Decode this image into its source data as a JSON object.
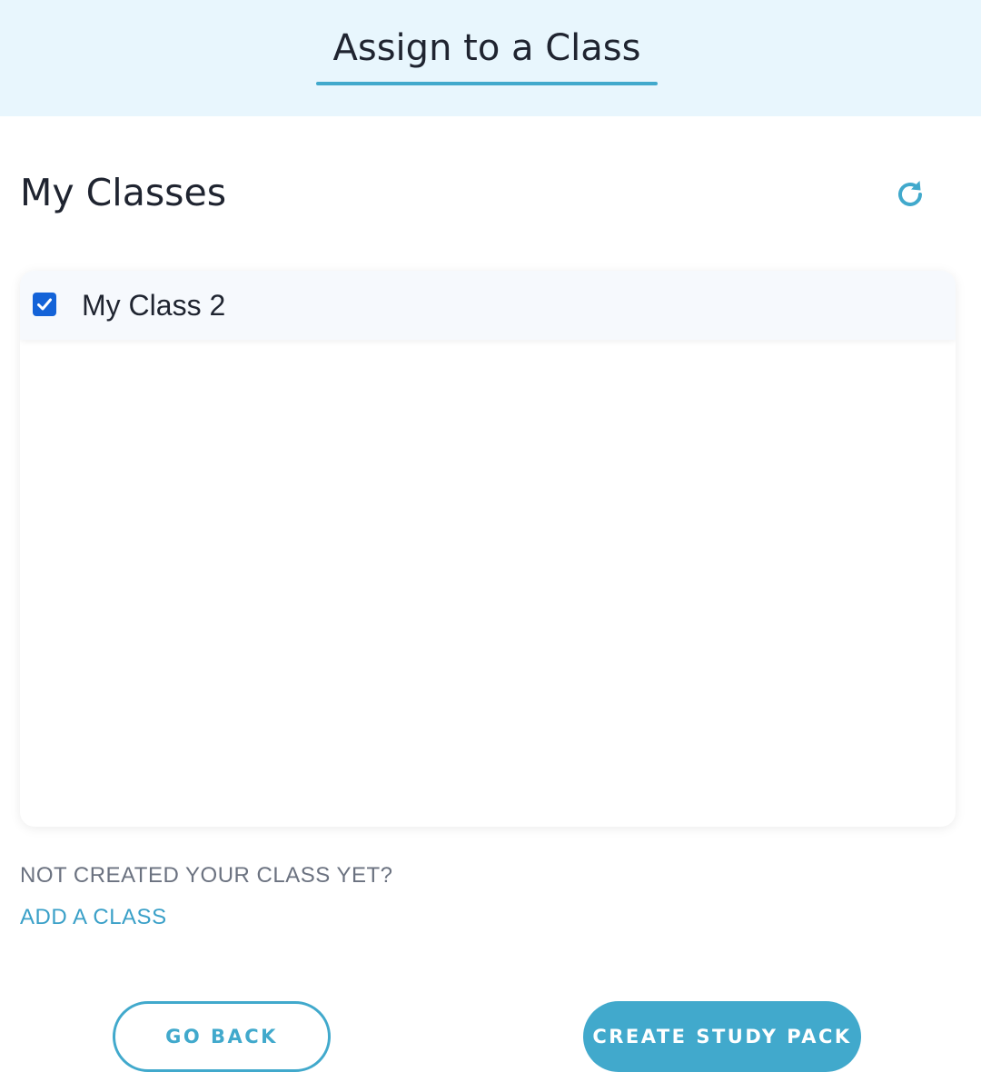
{
  "header": {
    "title": "Assign to a Class"
  },
  "classes_section": {
    "title": "My Classes",
    "refresh_icon": "refresh-icon",
    "items": [
      {
        "label": "My Class 2",
        "checked": true
      }
    ]
  },
  "footer_prompt": {
    "text": "NOT CREATED YOUR CLASS YET?",
    "link": "ADD A CLASS"
  },
  "actions": {
    "back_label": "GO BACK",
    "create_label": "CREATE STUDY PACK"
  },
  "colors": {
    "accent": "#41a9cc",
    "header_bg": "#e8f6fd",
    "checkbox": "#1463d8"
  }
}
